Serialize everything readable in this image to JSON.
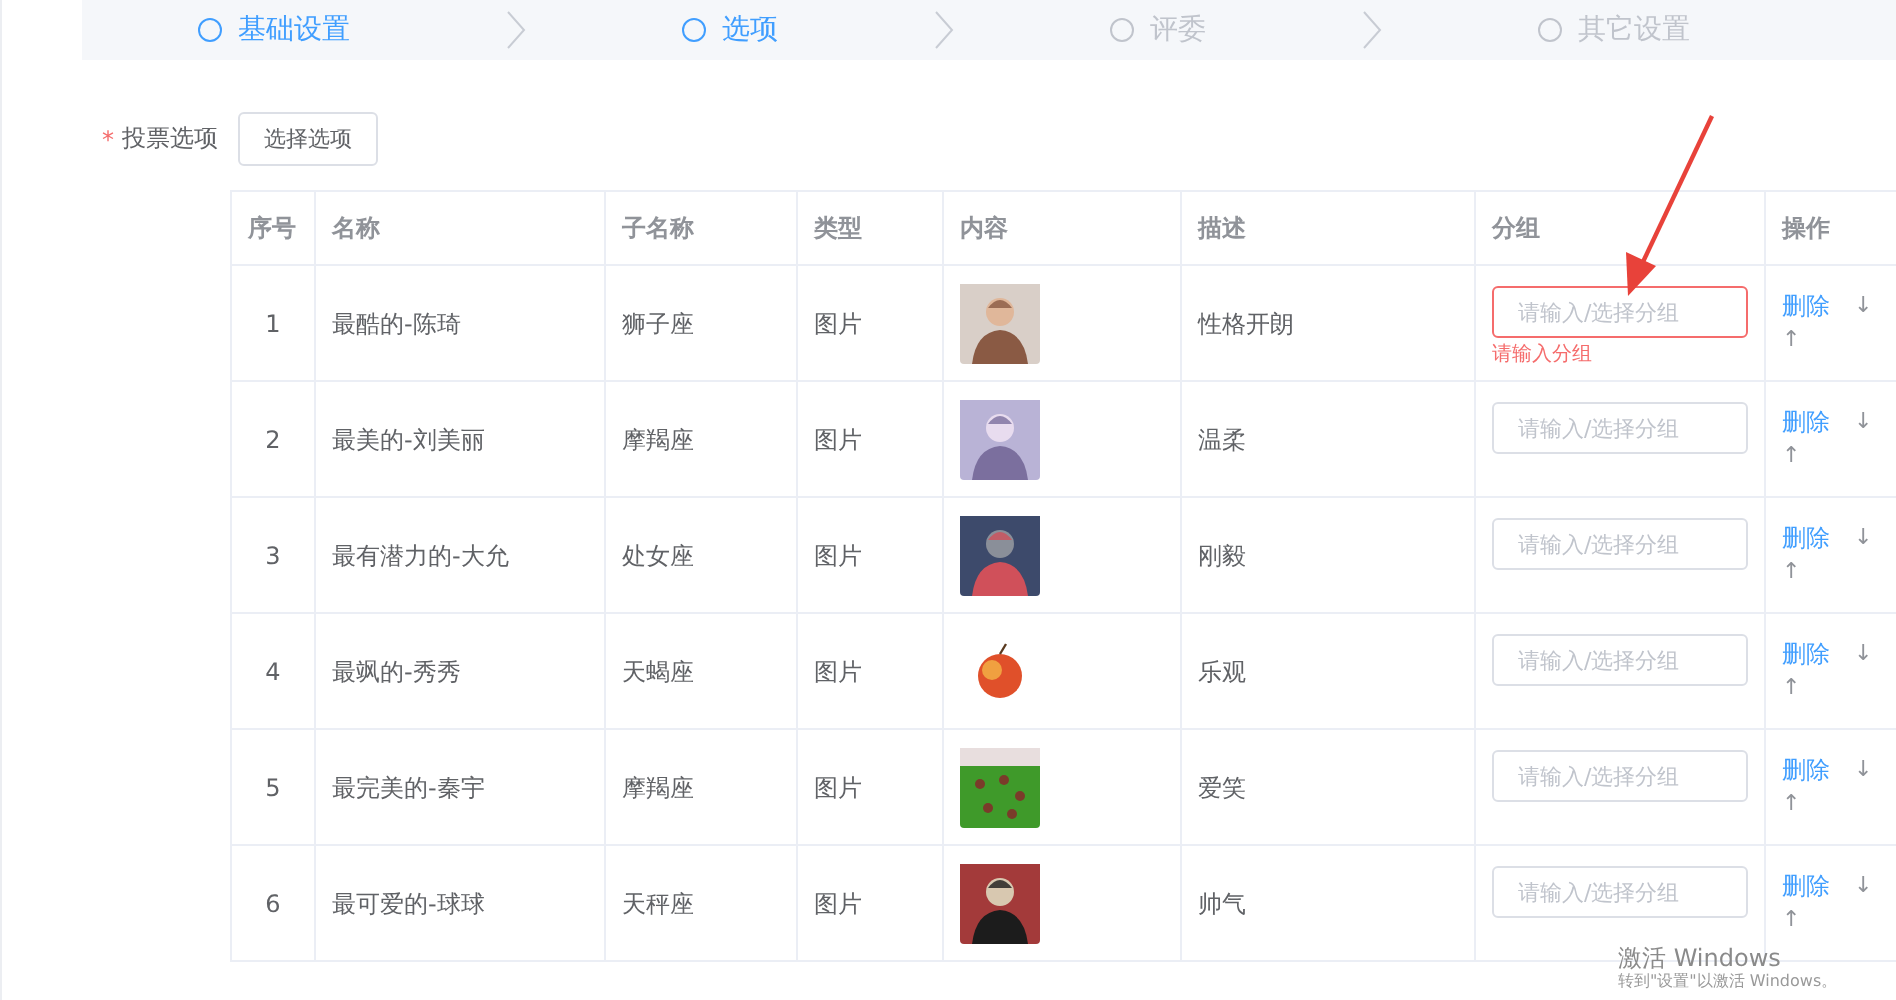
{
  "steps": [
    {
      "label": "基础设置",
      "active": true
    },
    {
      "label": "选项",
      "active": true
    },
    {
      "label": "评委",
      "active": false
    },
    {
      "label": "其它设置",
      "active": false
    }
  ],
  "form": {
    "required_mark": "*",
    "label": "投票选项",
    "button": "选择选项"
  },
  "table": {
    "columns": [
      "序号",
      "名称",
      "子名称",
      "类型",
      "内容",
      "描述",
      "分组",
      "操作"
    ],
    "rows": [
      {
        "index": "1",
        "name": "最酷的-陈琦",
        "sub_name": "狮子座",
        "type": "图片",
        "description": "性格开朗",
        "group": {
          "placeholder": "请输入/选择分组",
          "error": "请输入分组"
        },
        "actions": {
          "delete": "删除",
          "down": "↓",
          "up": "↑"
        }
      },
      {
        "index": "2",
        "name": "最美的-刘美丽",
        "sub_name": "摩羯座",
        "type": "图片",
        "description": "温柔",
        "group": {
          "placeholder": "请输入/选择分组"
        },
        "actions": {
          "delete": "删除",
          "down": "↓",
          "up": "↑"
        }
      },
      {
        "index": "3",
        "name": "最有潜力的-大允",
        "sub_name": "处女座",
        "type": "图片",
        "description": "刚毅",
        "group": {
          "placeholder": "请输入/选择分组"
        },
        "actions": {
          "delete": "删除",
          "down": "↓",
          "up": "↑"
        }
      },
      {
        "index": "4",
        "name": "最飒的-秀秀",
        "sub_name": "天蝎座",
        "type": "图片",
        "description": "乐观",
        "group": {
          "placeholder": "请输入/选择分组"
        },
        "actions": {
          "delete": "删除",
          "down": "↓",
          "up": "↑"
        }
      },
      {
        "index": "5",
        "name": "最完美的-秦宇",
        "sub_name": "摩羯座",
        "type": "图片",
        "description": "爱笑",
        "group": {
          "placeholder": "请输入/选择分组"
        },
        "actions": {
          "delete": "删除",
          "down": "↓",
          "up": "↑"
        }
      },
      {
        "index": "6",
        "name": "最可爱的-球球",
        "sub_name": "天秤座",
        "type": "图片",
        "description": "帅气",
        "group": {
          "placeholder": "请输入/选择分组"
        },
        "actions": {
          "delete": "删除",
          "down": "↓",
          "up": "↑"
        }
      }
    ]
  },
  "os_notice": {
    "title": "激活 Windows",
    "subtitle": "转到\"设置\"以激活 Windows。"
  }
}
